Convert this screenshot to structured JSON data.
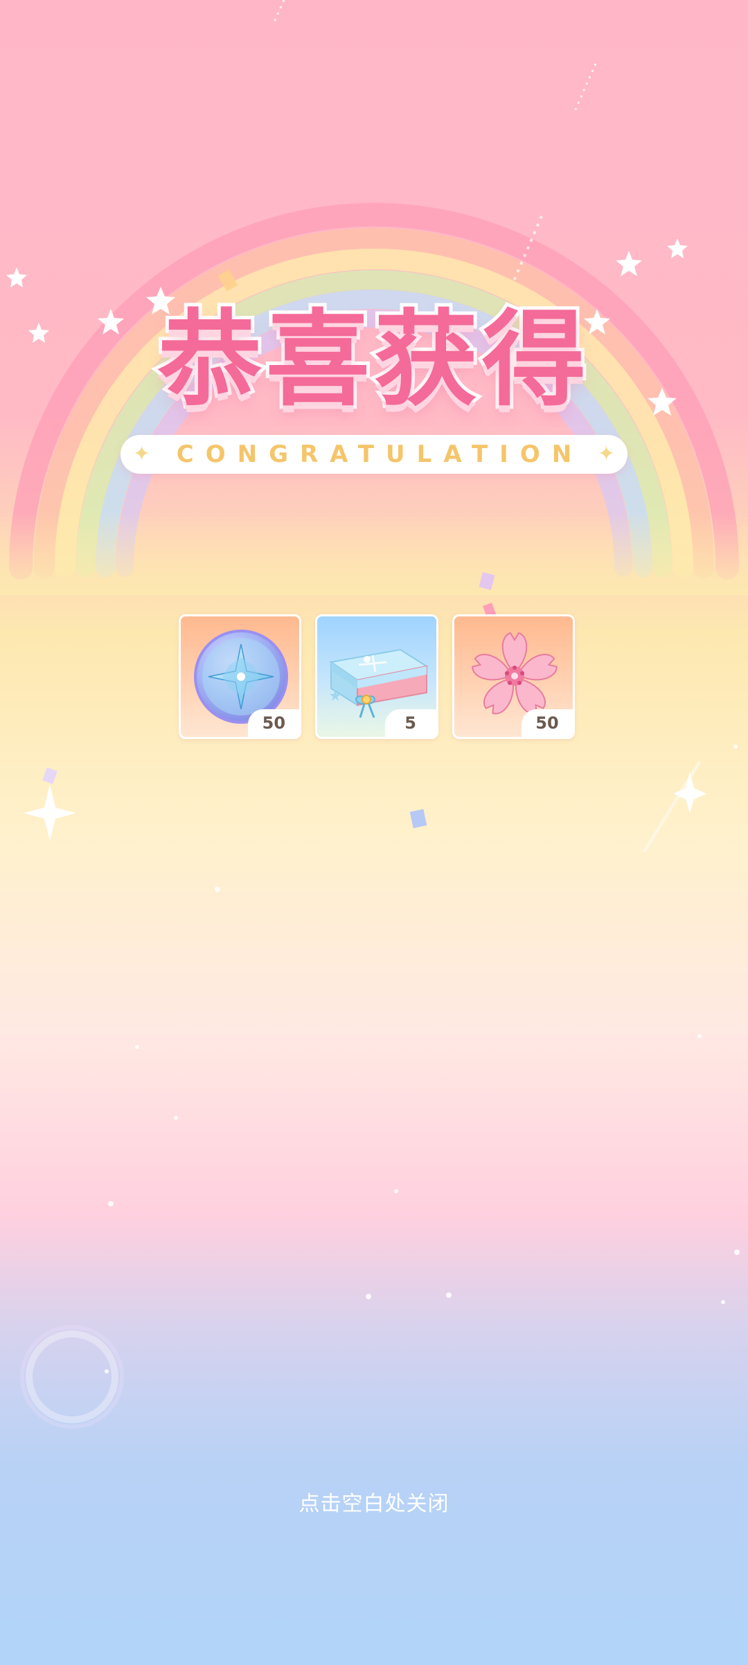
{
  "title": "恭喜获得",
  "subtitle": "CONGRATULATION",
  "rewards": [
    {
      "icon": "compass-coin-icon",
      "quantity": "50"
    },
    {
      "icon": "gift-box-icon",
      "quantity": "5"
    },
    {
      "icon": "sakura-flower-icon",
      "quantity": "50"
    }
  ],
  "close_hint": "点击空白处关闭",
  "colors": {
    "title_pink": "#f46a98",
    "subtitle_gold": "#f5c56a",
    "quantity_text": "#6b5a4e"
  }
}
